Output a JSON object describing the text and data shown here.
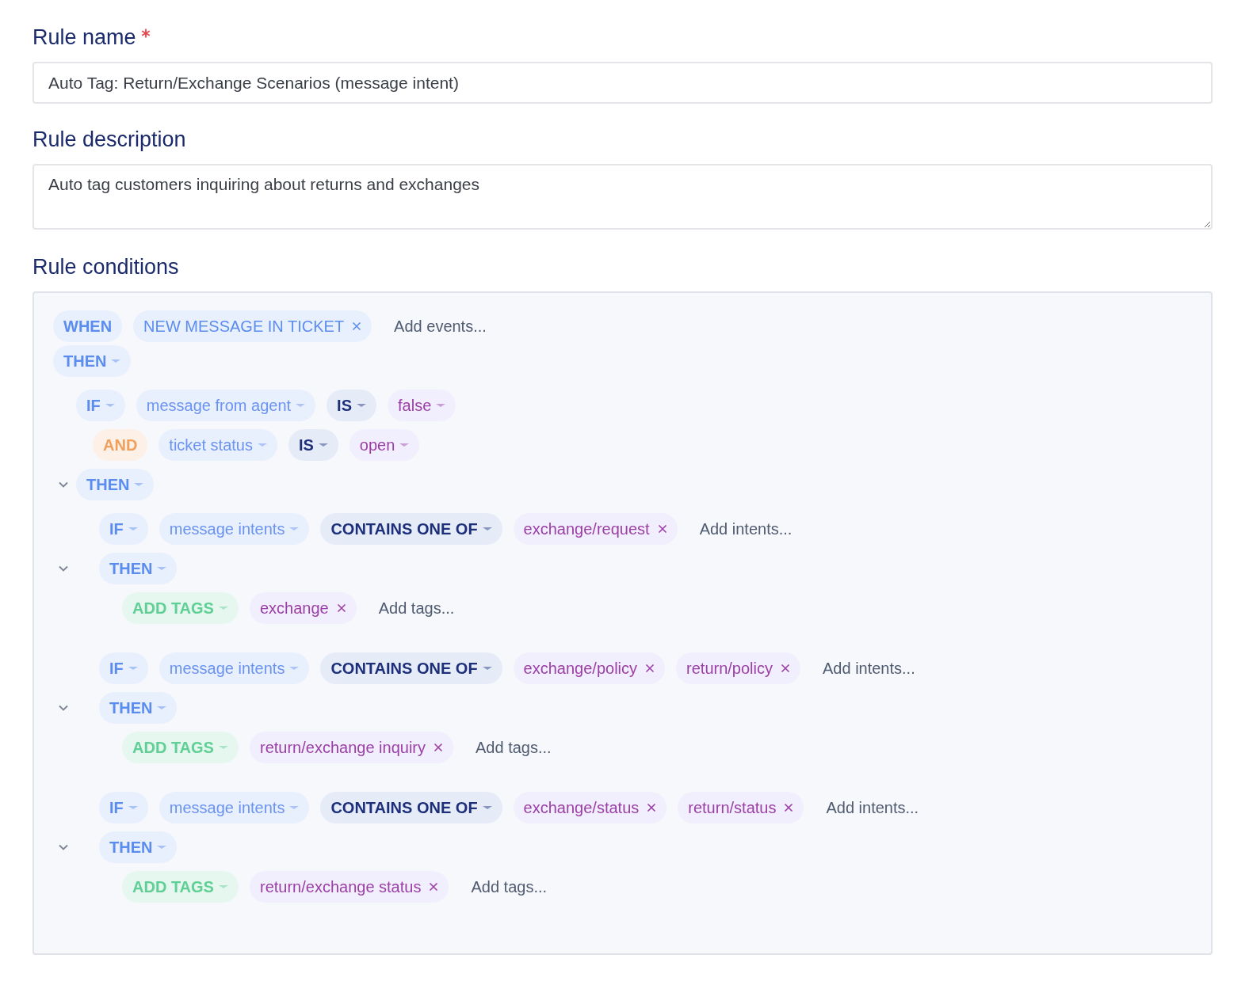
{
  "fields": [
    {
      "kind": "input",
      "label": "Rule name",
      "required": true,
      "value": "Auto Tag: Return/Exchange Scenarios (message intent)"
    },
    {
      "kind": "textarea",
      "label": "Rule description",
      "value": "Auto tag customers inquiring about returns and exchanges"
    }
  ],
  "conditions": {
    "label": "Rule conditions",
    "tree": [
      {
        "kind": "when",
        "chips": [
          {
            "kind": "keyword",
            "text": "WHEN",
            "dropdown": false,
            "removable": false
          },
          {
            "kind": "event",
            "text": "NEW MESSAGE IN TICKET",
            "dropdown": false,
            "removable": true
          }
        ],
        "add_text": "Add events..."
      },
      {
        "kind": "then",
        "chips": [
          {
            "kind": "keyword",
            "text": "THEN",
            "dropdown": true,
            "removable": false
          }
        ],
        "children": [
          {
            "kind": "if",
            "chips": [
              {
                "kind": "keyword",
                "text": "IF",
                "dropdown": true,
                "removable": false
              },
              {
                "kind": "field",
                "text": "message from agent",
                "dropdown": true,
                "removable": false
              },
              {
                "kind": "operator",
                "text": "IS",
                "dropdown": true,
                "removable": false
              },
              {
                "kind": "value",
                "text": "false",
                "dropdown": true,
                "removable": false
              }
            ],
            "children": [
              {
                "kind": "and",
                "chips": [
                  {
                    "kind": "and",
                    "text": "AND",
                    "dropdown": false,
                    "removable": false
                  },
                  {
                    "kind": "field",
                    "text": "ticket status",
                    "dropdown": true,
                    "removable": false
                  },
                  {
                    "kind": "operator",
                    "text": "IS",
                    "dropdown": true,
                    "removable": false
                  },
                  {
                    "kind": "value",
                    "text": "open",
                    "dropdown": true,
                    "removable": false
                  }
                ]
              }
            ]
          },
          {
            "kind": "then",
            "expanded": true,
            "chips": [
              {
                "kind": "keyword",
                "text": "THEN",
                "dropdown": true,
                "removable": false
              }
            ],
            "children": [
              {
                "kind": "if",
                "chips": [
                  {
                    "kind": "keyword",
                    "text": "IF",
                    "dropdown": true,
                    "removable": false
                  },
                  {
                    "kind": "field",
                    "text": "message intents",
                    "dropdown": true,
                    "removable": false
                  },
                  {
                    "kind": "operator",
                    "text": "CONTAINS ONE OF",
                    "dropdown": true,
                    "removable": false
                  },
                  {
                    "kind": "value",
                    "text": "exchange/request",
                    "dropdown": false,
                    "removable": true
                  }
                ],
                "add_text": "Add intents..."
              },
              {
                "kind": "then",
                "expanded": true,
                "chips": [
                  {
                    "kind": "keyword",
                    "text": "THEN",
                    "dropdown": true,
                    "removable": false
                  }
                ],
                "children": [
                  {
                    "kind": "action",
                    "chips": [
                      {
                        "kind": "action",
                        "text": "ADD TAGS",
                        "dropdown": true,
                        "removable": false
                      },
                      {
                        "kind": "value",
                        "text": "exchange",
                        "dropdown": false,
                        "removable": true
                      }
                    ],
                    "add_text": "Add tags..."
                  }
                ]
              },
              {
                "kind": "if",
                "chips": [
                  {
                    "kind": "keyword",
                    "text": "IF",
                    "dropdown": true,
                    "removable": false
                  },
                  {
                    "kind": "field",
                    "text": "message intents",
                    "dropdown": true,
                    "removable": false
                  },
                  {
                    "kind": "operator",
                    "text": "CONTAINS ONE OF",
                    "dropdown": true,
                    "removable": false
                  },
                  {
                    "kind": "value",
                    "text": "exchange/policy",
                    "dropdown": false,
                    "removable": true
                  },
                  {
                    "kind": "value",
                    "text": "return/policy",
                    "dropdown": false,
                    "removable": true
                  }
                ],
                "add_text": "Add intents..."
              },
              {
                "kind": "then",
                "expanded": true,
                "chips": [
                  {
                    "kind": "keyword",
                    "text": "THEN",
                    "dropdown": true,
                    "removable": false
                  }
                ],
                "children": [
                  {
                    "kind": "action",
                    "chips": [
                      {
                        "kind": "action",
                        "text": "ADD TAGS",
                        "dropdown": true,
                        "removable": false
                      },
                      {
                        "kind": "value",
                        "text": "return/exchange inquiry",
                        "dropdown": false,
                        "removable": true
                      }
                    ],
                    "add_text": "Add tags..."
                  }
                ]
              },
              {
                "kind": "if",
                "chips": [
                  {
                    "kind": "keyword",
                    "text": "IF",
                    "dropdown": true,
                    "removable": false
                  },
                  {
                    "kind": "field",
                    "text": "message intents",
                    "dropdown": true,
                    "removable": false
                  },
                  {
                    "kind": "operator",
                    "text": "CONTAINS ONE OF",
                    "dropdown": true,
                    "removable": false
                  },
                  {
                    "kind": "value",
                    "text": "exchange/status",
                    "dropdown": false,
                    "removable": true
                  },
                  {
                    "kind": "value",
                    "text": "return/status",
                    "dropdown": false,
                    "removable": true
                  }
                ],
                "add_text": "Add intents..."
              },
              {
                "kind": "then",
                "expanded": true,
                "chips": [
                  {
                    "kind": "keyword",
                    "text": "THEN",
                    "dropdown": true,
                    "removable": false
                  }
                ],
                "children": [
                  {
                    "kind": "action",
                    "chips": [
                      {
                        "kind": "action",
                        "text": "ADD TAGS",
                        "dropdown": true,
                        "removable": false
                      },
                      {
                        "kind": "value",
                        "text": "return/exchange status",
                        "dropdown": false,
                        "removable": true
                      }
                    ],
                    "add_text": "Add tags..."
                  }
                ]
              }
            ]
          }
        ]
      }
    ]
  }
}
